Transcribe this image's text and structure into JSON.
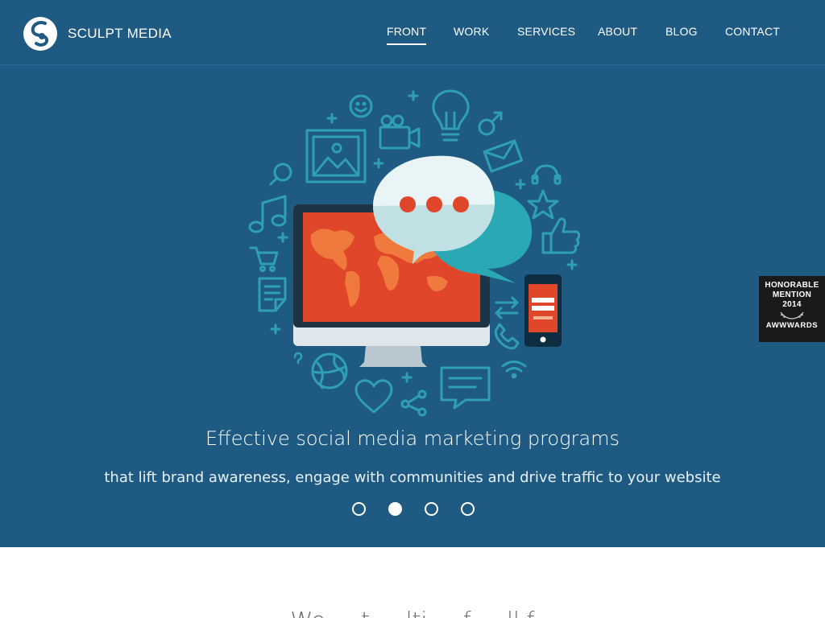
{
  "brand": {
    "name": "SCULPT MEDIA"
  },
  "nav": {
    "items": [
      {
        "label": "FRONT",
        "active": true
      },
      {
        "label": "WORK",
        "active": false
      },
      {
        "label": "SERVICES",
        "active": false
      },
      {
        "label": "ABOUT",
        "active": false
      },
      {
        "label": "BLOG",
        "active": false
      },
      {
        "label": "CONTACT",
        "active": false
      }
    ]
  },
  "hero": {
    "headline": "Effective social media marketing programs",
    "subline": "that lift brand awareness, engage with communities and drive traffic to your website",
    "slides": {
      "count": 4,
      "active_index": 1
    },
    "illustration_icons": [
      "smiley-icon",
      "lightbulb-icon",
      "camera-icon",
      "image-icon",
      "male-icon",
      "envelope-icon",
      "search-icon",
      "headset-icon",
      "music-icon",
      "star-icon",
      "cart-icon",
      "thumbs-up-icon",
      "document-icon",
      "transfer-icon",
      "phone-icon",
      "question-icon",
      "globe-icon",
      "heart-icon",
      "share-icon",
      "chat-icon",
      "wifi-icon",
      "monitor-icon",
      "mobile-icon",
      "speech-bubble-icon"
    ]
  },
  "badge": {
    "line1": "HONORABLE",
    "line2": "MENTION",
    "year": "2014",
    "brand": "AWWWARDS"
  },
  "below": {
    "intro_fragment": "We ... t ... lti ... f ... ll f"
  },
  "colors": {
    "hero_bg": "#1e5a82",
    "accent": "#e0472a",
    "teal": "#2aa8b4",
    "white": "#ffffff",
    "line_icon": "#2f9fb3"
  }
}
